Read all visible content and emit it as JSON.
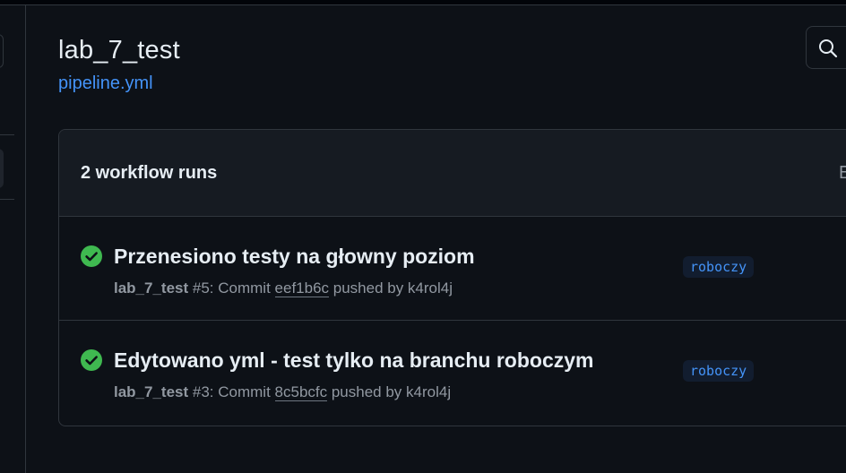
{
  "workflow": {
    "title": "lab_7_test",
    "file": "pipeline.yml"
  },
  "runs": {
    "count_label": "2 workflow runs",
    "filter_fragment": "E",
    "items": [
      {
        "status": "success",
        "title": "Przenesiono testy na głowny poziom",
        "workflow_name": "lab_7_test",
        "event_prefix": " #5: Commit ",
        "sha": "eef1b6c",
        "event_suffix": " pushed by k4rol4j",
        "branch": "roboczy"
      },
      {
        "status": "success",
        "title": "Edytowano yml - test tylko na branchu roboczym",
        "workflow_name": "lab_7_test",
        "event_prefix": " #3: Commit ",
        "sha": "8c5bcfc",
        "event_suffix": " pushed by k4rol4j",
        "branch": "roboczy"
      }
    ]
  },
  "icons": {
    "search": "search-icon",
    "success": "check-circle-fill-icon"
  },
  "colors": {
    "background": "#0d1117",
    "border": "#30363d",
    "link": "#4493f8",
    "success": "#3fb950",
    "muted": "#9198a1"
  }
}
